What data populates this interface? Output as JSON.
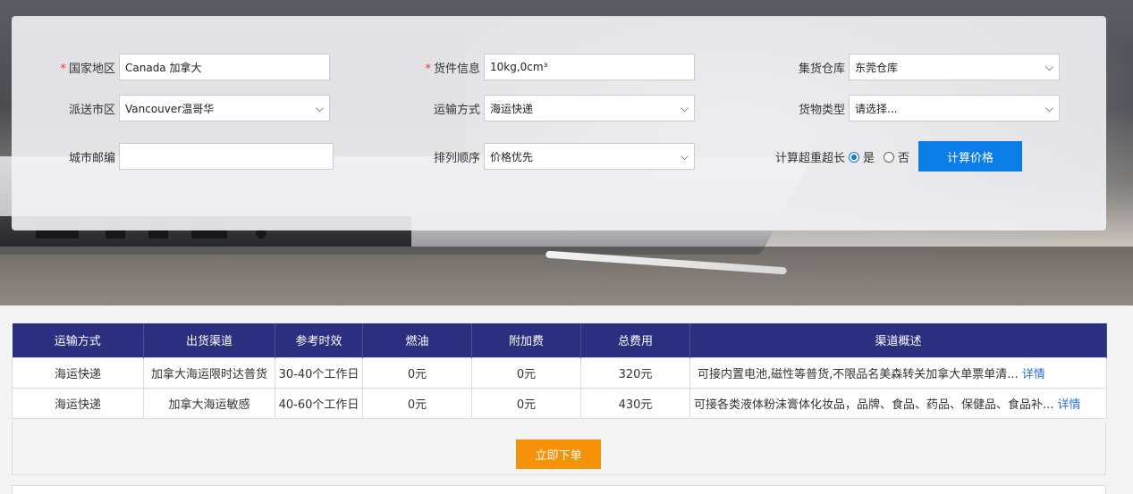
{
  "form": {
    "country": {
      "label": "国家地区",
      "value": "Canada 加拿大"
    },
    "cargo": {
      "label": "货件信息",
      "value": "10kg,0cm³"
    },
    "warehouse": {
      "label": "集货仓库",
      "value": "东莞仓库"
    },
    "city": {
      "label": "派送市区",
      "value": "Vancouver温哥华"
    },
    "transport": {
      "label": "运输方式",
      "value": "海运快递"
    },
    "goods_type": {
      "label": "货物类型",
      "value": "请选择..."
    },
    "postcode": {
      "label": "城市邮编",
      "value": ""
    },
    "sort": {
      "label": "排列顺序",
      "value": "价格优先"
    },
    "oversize": {
      "label": "计算超重超长",
      "yes": "是",
      "no": "否",
      "selected": "yes"
    },
    "calc_button": "计算价格",
    "required_mark": "*"
  },
  "table": {
    "headers": [
      "运输方式",
      "出货渠道",
      "参考时效",
      "燃油",
      "附加费",
      "总费用",
      "渠道概述"
    ],
    "rows": [
      {
        "method": "海运快递",
        "channel": "加拿大海运限时达普货",
        "time": "30-40个工作日",
        "fuel": "0元",
        "surcharge": "0元",
        "total": "320元",
        "desc": "可接内置电池,磁性等普货,不限品名美森转关加拿大单票单清...",
        "detail": "详情"
      },
      {
        "method": "海运快递",
        "channel": "加拿大海运敏感",
        "time": "40-60个工作日",
        "fuel": "0元",
        "surcharge": "0元",
        "total": "430元",
        "desc": "可接各类液体粉沫膏体化妆品，品牌、食品、药品、保健品、食品补...",
        "detail": "详情"
      }
    ]
  },
  "order_button": "立即下单",
  "colors": {
    "header_bg": "#2c2f7f",
    "primary": "#0b7de6",
    "order": "#f5920a",
    "required": "#e33333",
    "link": "#2b6fd6"
  }
}
